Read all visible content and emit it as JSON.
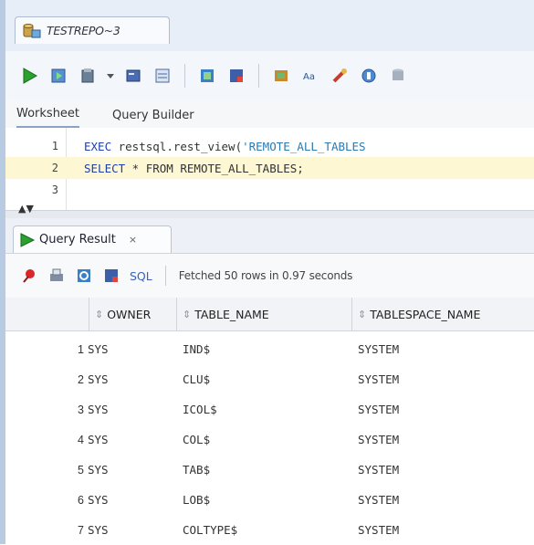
{
  "document_tab": {
    "label": "TESTREPO~3"
  },
  "toolbar": {
    "icons": [
      "run-statement-icon",
      "run-script-icon",
      "commit-icon",
      "dropdown-icon",
      "explain-plan-icon",
      "autotrace-icon",
      "sql-tuning-icon",
      "unshared-sql-icon",
      "sql-history-icon",
      "text-case-icon",
      "clear-icon",
      "format-icon",
      "database-icon"
    ]
  },
  "subtabs": {
    "worksheet": "Worksheet",
    "query_builder": "Query Builder"
  },
  "editor": {
    "lines": [
      {
        "num": "1",
        "kw1": "EXEC",
        "text": " restsql.rest_view(",
        "str": "'REMOTE_ALL_TABLES"
      },
      {
        "num": "2",
        "kw1": "SELECT",
        "text": " * FROM REMOTE_ALL_TABLES;"
      },
      {
        "num": "3"
      }
    ]
  },
  "result": {
    "tab_label": "Query Result",
    "tab_close": "×",
    "sql_label": "SQL",
    "status": "Fetched 50 rows in 0.97 seconds",
    "columns": [
      "OWNER",
      "TABLE_NAME",
      "TABLESPACE_NAME"
    ],
    "rows": [
      {
        "num": "1",
        "owner": "SYS",
        "table": "IND$",
        "ts": "SYSTEM"
      },
      {
        "num": "2",
        "owner": "SYS",
        "table": "CLU$",
        "ts": "SYSTEM"
      },
      {
        "num": "3",
        "owner": "SYS",
        "table": "ICOL$",
        "ts": "SYSTEM"
      },
      {
        "num": "4",
        "owner": "SYS",
        "table": "COL$",
        "ts": "SYSTEM"
      },
      {
        "num": "5",
        "owner": "SYS",
        "table": "TAB$",
        "ts": "SYSTEM"
      },
      {
        "num": "6",
        "owner": "SYS",
        "table": "LOB$",
        "ts": "SYSTEM"
      },
      {
        "num": "7",
        "owner": "SYS",
        "table": "COLTYPE$",
        "ts": "SYSTEM"
      }
    ]
  },
  "colors": {
    "accent": "#b9cbe3",
    "keyword": "#1e3fb0",
    "string": "#2c7ab0",
    "highlight": "#fdf7d4"
  }
}
